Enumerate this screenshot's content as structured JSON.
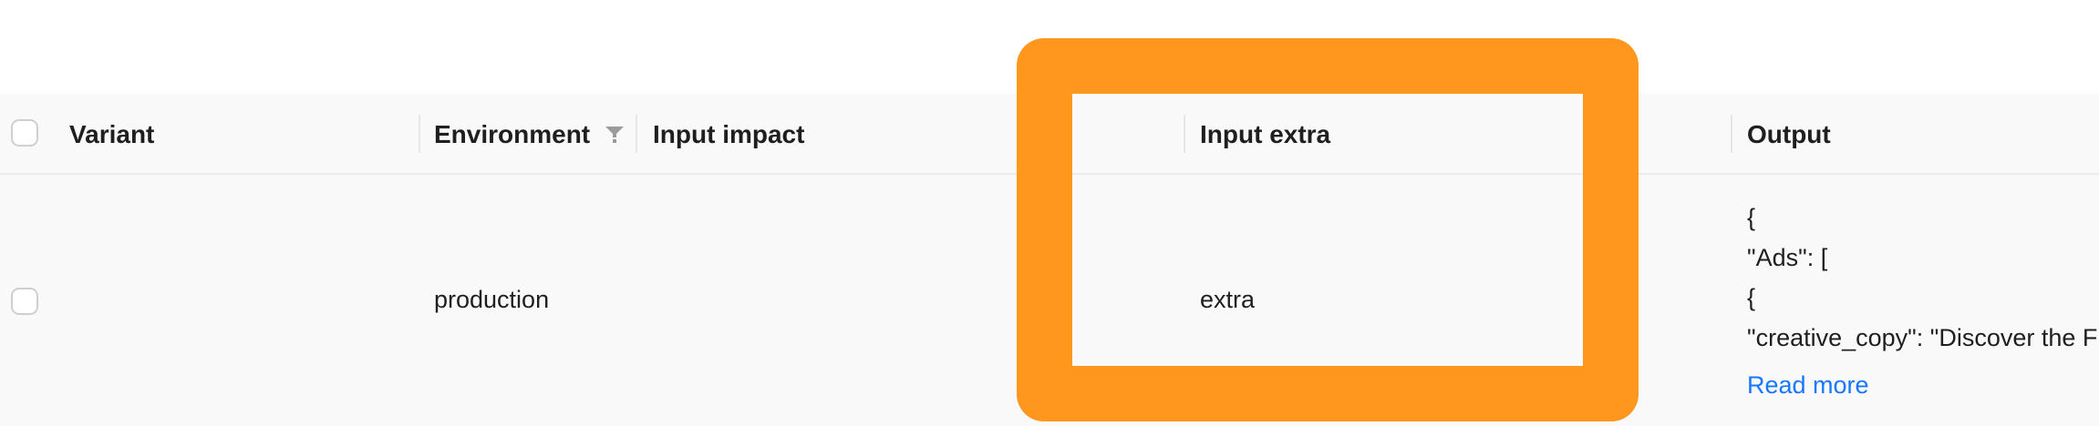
{
  "table": {
    "columns": [
      {
        "key": "variant",
        "label": "Variant"
      },
      {
        "key": "environment",
        "label": "Environment"
      },
      {
        "key": "input_impact",
        "label": "Input impact"
      },
      {
        "key": "input_extra",
        "label": "Input extra"
      },
      {
        "key": "output",
        "label": "Output"
      }
    ],
    "rows": [
      {
        "variant": "",
        "environment": "production",
        "input_impact": "",
        "input_extra": "extra",
        "output_lines": [
          "{",
          "\"Ads\": [",
          "{",
          "\"creative_copy\": \"Discover the Future of Smart Living with Our Innovative Products! Experience Convenience Like Never Before.\","
        ],
        "read_more": "Read more"
      }
    ]
  },
  "icons": {
    "filter": "filter-icon",
    "checkbox": "checkbox-icon"
  },
  "colors": {
    "highlight": "#ff961e",
    "link": "#1677ff",
    "table_bg": "#f9f9f9"
  }
}
